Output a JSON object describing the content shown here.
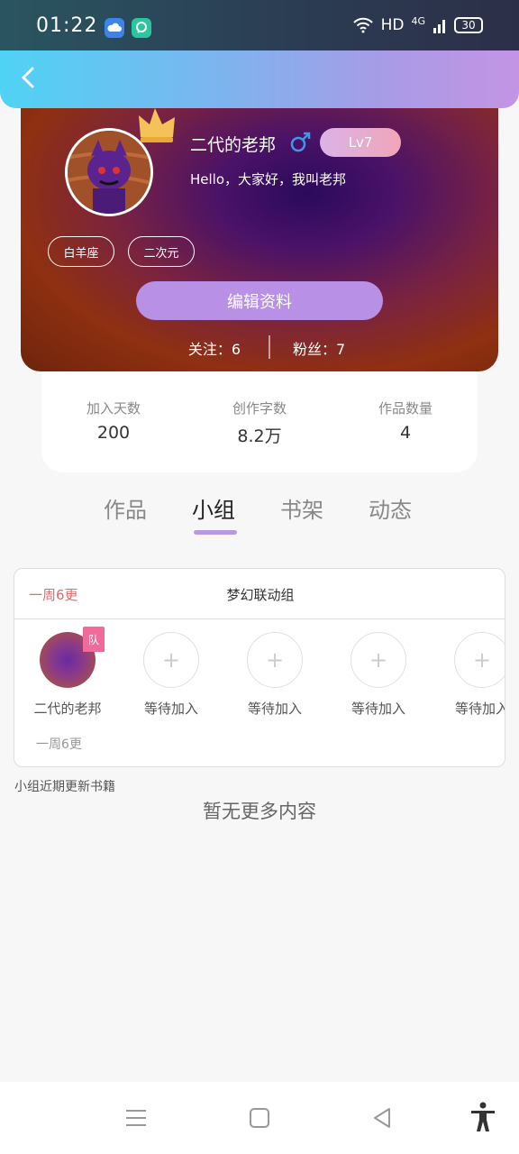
{
  "status_bar": {
    "time": "01:22",
    "network": "HD",
    "signal": "4G",
    "battery": "30"
  },
  "profile": {
    "username": "二代的老邦",
    "gender_icon": "male-icon",
    "level": "Lv7",
    "bio": "Hello，大家好，我叫老邦",
    "tags": [
      "白羊座",
      "二次元"
    ],
    "edit_label": "编辑资料",
    "following": "关注：6",
    "followers": "粉丝：7"
  },
  "stats": [
    {
      "label": "加入天数",
      "value": "200"
    },
    {
      "label": "创作字数",
      "value": "8.2万"
    },
    {
      "label": "作品数量",
      "value": "4"
    }
  ],
  "tabs": [
    {
      "label": "作品",
      "active": false
    },
    {
      "label": "小组",
      "active": true
    },
    {
      "label": "书架",
      "active": false
    },
    {
      "label": "动态",
      "active": false
    }
  ],
  "group": {
    "update_freq": "一周6更",
    "name": "梦幻联动组",
    "team_flag": "队",
    "members": [
      {
        "name": "二代的老邦",
        "filled": true
      },
      {
        "name": "等待加入",
        "filled": false
      },
      {
        "name": "等待加入",
        "filled": false
      },
      {
        "name": "等待加入",
        "filled": false
      },
      {
        "name": "等待加入",
        "filled": false
      }
    ],
    "footer": "一周6更"
  },
  "recent_label": "小组近期更新书籍",
  "empty_message": "暂无更多内容",
  "colors": {
    "accent": "#b890e6",
    "update_red": "#e26a6a",
    "level_gradient_start": "#dcb2e8",
    "level_gradient_end": "#f0a6b8"
  }
}
